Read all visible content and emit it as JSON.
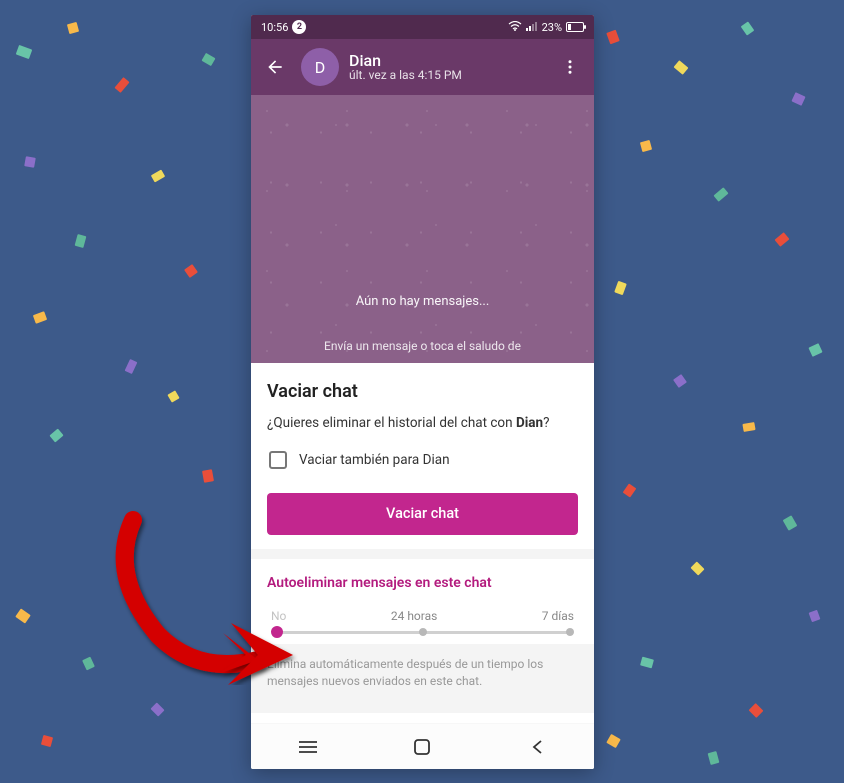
{
  "status_bar": {
    "time": "10:56",
    "notification_count": "2",
    "battery_text": "23%"
  },
  "chat_header": {
    "avatar_letter": "D",
    "contact_name": "Dian",
    "last_seen": "últ. vez a las 4:15 PM"
  },
  "chat_body": {
    "empty_title": "Aún no hay mensajes...",
    "empty_hint": "Envía un mensaje o toca el saludo de"
  },
  "modal": {
    "title": "Vaciar chat",
    "question_prefix": "¿Quieres eliminar el historial del chat con ",
    "question_name": "Dian",
    "question_suffix": "?",
    "checkbox_label": "Vaciar también para Dian",
    "button_label": "Vaciar chat"
  },
  "auto_delete": {
    "title": "Autoeliminar mensajes en este chat",
    "options": [
      "No",
      "24 horas",
      "7 días"
    ],
    "selected_index": 0,
    "note": "Elimina automáticamente después de un tiempo los mensajes nuevos enviados en este chat."
  },
  "colors": {
    "accent": "#c2268e",
    "header": "#6a3968",
    "status": "#502a4e"
  }
}
